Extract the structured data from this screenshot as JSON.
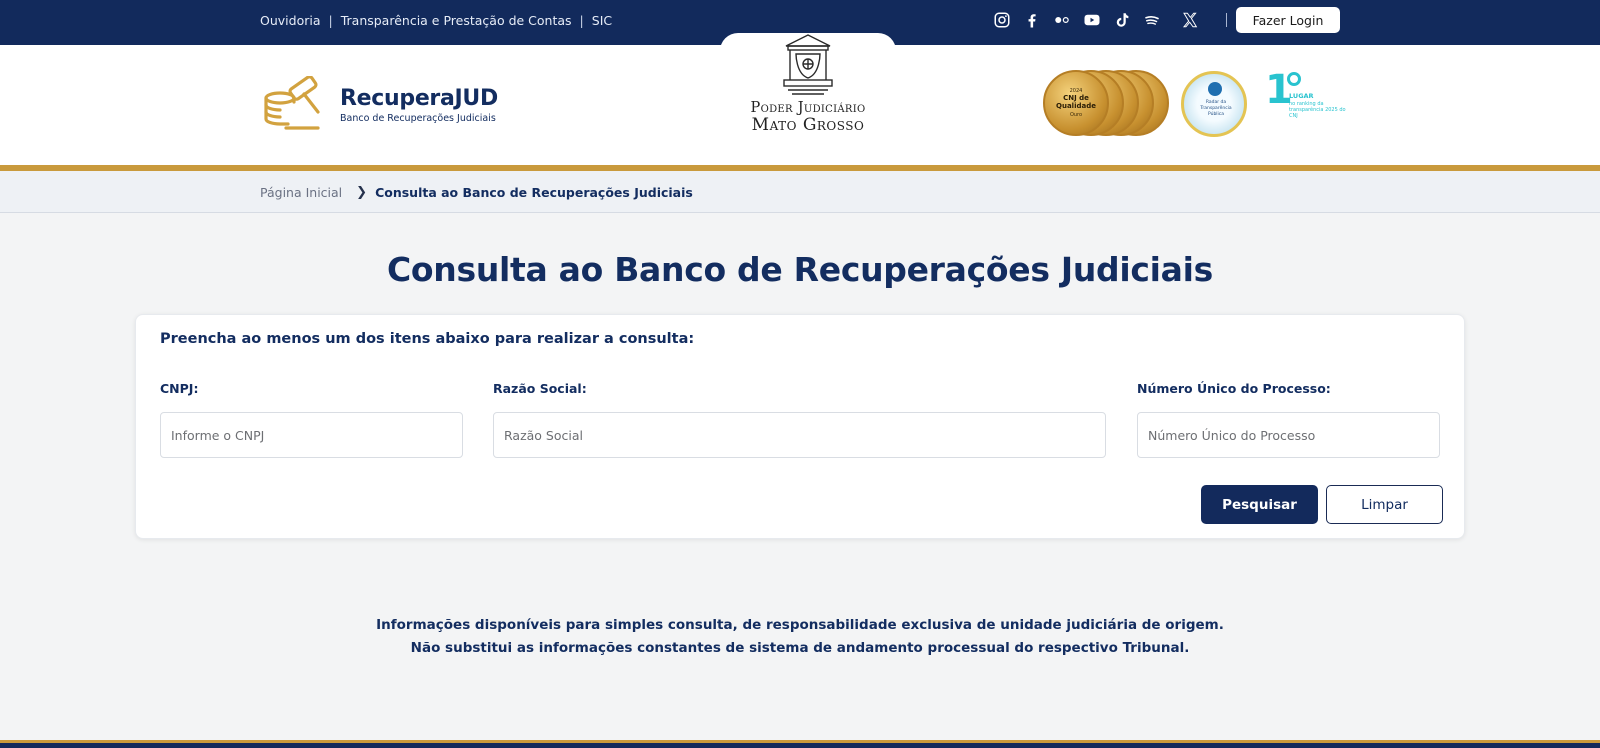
{
  "topbar": {
    "links": [
      "Ouvidoria",
      "Transparência e Prestação de Contas",
      "SIC"
    ],
    "separator": "|",
    "socials": [
      "instagram-icon",
      "facebook-icon",
      "flickr-icon",
      "youtube-icon",
      "tiktok-icon",
      "spotify-icon",
      "x-icon"
    ],
    "login_label": "Fazer Login"
  },
  "header": {
    "app_title": "RecuperaJUD",
    "app_subtitle": "Banco de Recuperações Judiciais",
    "institution_line1": "Poder Judiciário",
    "institution_line2": "Mato Grosso",
    "seal_gold": {
      "year": "2024",
      "title": "CNJ de Qualidade",
      "level": "Ouro"
    },
    "seal_blue_text": "Radar da Transparência Pública",
    "ranking": {
      "place": "1",
      "word": "LUGAR",
      "text": "no ranking da transparência 2025 do CNJ"
    }
  },
  "breadcrumb": {
    "home": "Página Inicial",
    "separator": "❯",
    "current": "Consulta ao Banco de Recuperações Judiciais"
  },
  "main": {
    "title": "Consulta ao Banco de Recuperações Judiciais",
    "form": {
      "lead": "Preencha ao menos um dos itens abaixo para realizar a consulta:",
      "cnpj_label": "CNPJ:",
      "cnpj_placeholder": "Informe o CNPJ",
      "cnpj_value": "",
      "razao_label": "Razão Social:",
      "razao_placeholder": "Razão Social",
      "razao_value": "",
      "processo_label": "Número Único do Processo:",
      "processo_placeholder": "Número Único do Processo",
      "processo_value": "",
      "search_label": "Pesquisar",
      "clear_label": "Limpar"
    },
    "disclaimer_line1": "Informações disponíveis para simples consulta, de responsabilidade exclusiva de unidade judiciária de origem.",
    "disclaimer_line2": "Não substitui as informações constantes de sistema de andamento processual do respectivo Tribunal."
  },
  "colors": {
    "navy": "#122a5c",
    "gold": "#c99a3c",
    "title_blue": "#132d60",
    "teal": "#29c3cf"
  }
}
